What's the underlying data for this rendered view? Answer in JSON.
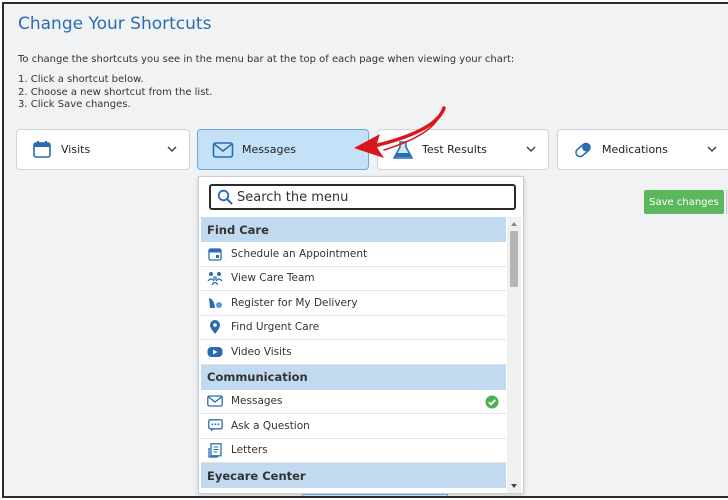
{
  "page": {
    "title": "Change Your Shortcuts",
    "intro": "To change the shortcuts you see in the menu bar at the top of each page when viewing your chart:",
    "steps": [
      "1. Click a shortcut below.",
      "2. Choose a new shortcut from the list.",
      "3. Click Save changes."
    ]
  },
  "shortcuts": [
    {
      "label": "Visits",
      "icon": "calendar-icon",
      "active": false
    },
    {
      "label": "Messages",
      "icon": "envelope-icon",
      "active": true
    },
    {
      "label": "Test Results",
      "icon": "flask-icon",
      "active": false
    },
    {
      "label": "Medications",
      "icon": "pills-icon",
      "active": false
    }
  ],
  "save_button": "Save changes",
  "menu": {
    "search_placeholder": "Search the menu",
    "sections": [
      {
        "title": "Find Care",
        "items": [
          {
            "label": "Schedule an Appointment",
            "icon": "calendar-icon"
          },
          {
            "label": "View Care Team",
            "icon": "care-team-icon"
          },
          {
            "label": "Register for My Delivery",
            "icon": "delivery-icon"
          },
          {
            "label": "Find Urgent Care",
            "icon": "map-pin-icon"
          },
          {
            "label": "Video Visits",
            "icon": "video-icon"
          }
        ]
      },
      {
        "title": "Communication",
        "items": [
          {
            "label": "Messages",
            "icon": "envelope-icon",
            "selected": true
          },
          {
            "label": "Ask a Question",
            "icon": "chat-icon"
          },
          {
            "label": "Letters",
            "icon": "letter-icon"
          }
        ]
      },
      {
        "title": "Eyecare Center",
        "items": []
      }
    ]
  },
  "colors": {
    "title_blue": "#2a6cb2",
    "active_tab": "#c5e1f7",
    "section_header": "#c2daf0",
    "save_green": "#5cb85c",
    "check_green": "#4caf50",
    "arrow_red": "#d9161c"
  }
}
